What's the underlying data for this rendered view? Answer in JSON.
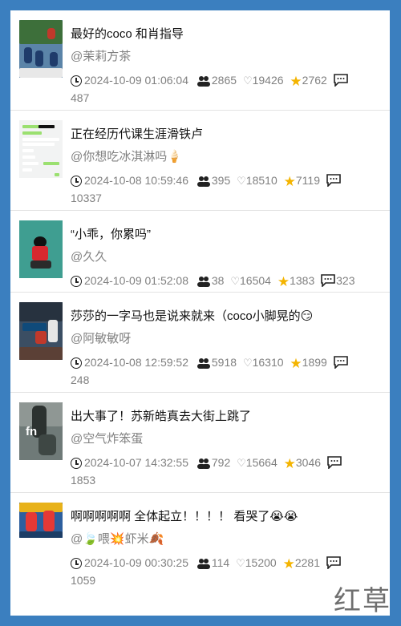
{
  "posts": [
    {
      "title": "最好的coco 和肖指导",
      "author": "@茉莉方茶",
      "date": "2024-10-09 01:06:04",
      "comments": "2865",
      "likes": "19426",
      "favorites": "2762",
      "replies": "487",
      "thumb": {
        "bg": "#5b84a8",
        "accent": "#c0392b"
      }
    },
    {
      "title": "正在经历代课生涯滑铁卢",
      "author": "@你想吃冰淇淋吗🍦",
      "date": "2024-10-08 10:59:46",
      "comments": "395",
      "likes": "18510",
      "favorites": "7119",
      "replies": "10337",
      "thumb": {
        "bg": "#f2f3f3",
        "accent": "#9be070"
      }
    },
    {
      "title": "“小乖，你累吗”",
      "author": "@久久",
      "date": "2024-10-09 01:52:08",
      "comments": "38",
      "likes": "16504",
      "favorites": "1383",
      "replies": "323",
      "thumb": {
        "bg": "#3f9e91",
        "accent": "#d7282f"
      }
    },
    {
      "title": "莎莎的一字马也是说来就来（coco小脚晃的😏",
      "author": "@阿敏敏呀",
      "date": "2024-10-08 12:59:52",
      "comments": "5918",
      "likes": "16310",
      "favorites": "1899",
      "replies": "248",
      "thumb": {
        "bg": "#3b4e63",
        "accent": "#c0392b"
      }
    },
    {
      "title": "出大事了！苏新皓真去大街上跳了",
      "author": "@空气炸笨蛋",
      "date": "2024-10-07 14:32:55",
      "comments": "792",
      "likes": "15664",
      "favorites": "3046",
      "replies": "1853",
      "thumb": {
        "bg": "#6f7a78",
        "accent": "#2c3230"
      }
    },
    {
      "title": "啊啊啊啊啊 全体起立！！！！ 看哭了😭😭",
      "author": "@🍃喂💥虾米🍂",
      "date": "2024-10-09 00:30:25",
      "comments": "114",
      "likes": "15200",
      "favorites": "2281",
      "replies": "1059",
      "thumb": {
        "bg": "#2d5f9e",
        "accent": "#e53935"
      }
    }
  ],
  "watermark": "红草",
  "colors": {
    "frame": "#3b7fbf",
    "star": "#f4b400",
    "muted": "#808080"
  }
}
